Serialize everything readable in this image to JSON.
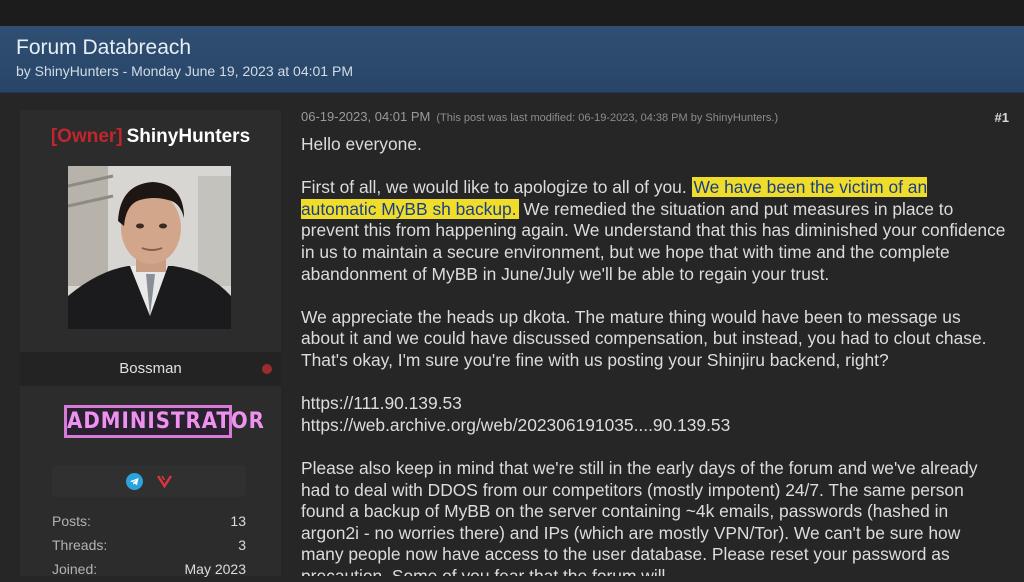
{
  "thread": {
    "title": "Forum Databreach",
    "byline": "by ShinyHunters - Monday June 19, 2023 at 04:01 PM"
  },
  "author": {
    "role_tag": "[Owner]",
    "name": "ShinyHunters",
    "user_title": "Bossman",
    "group_badge": "ADMINISTRATOR",
    "badge_color": "#d77bd7",
    "role_color": "#c0262e",
    "social_icons": [
      "telegram-icon",
      "vk-icon"
    ],
    "stats": [
      {
        "label": "Posts:",
        "value": "13"
      },
      {
        "label": "Threads:",
        "value": "3"
      },
      {
        "label": "Joined:",
        "value": "May 2023"
      }
    ]
  },
  "post": {
    "date": "06-19-2023, 04:01 PM",
    "modified": "(This post was last modified: 06-19-2023, 04:38 PM by ShinyHunters.)",
    "number": "#1",
    "greeting": "Hello everyone.",
    "p1_start": "First of all, we would like to apologize to all of you. ",
    "p1_highlight": "We have been the victim of an automatic MyBB sh backup.",
    "p1_end": " We remedied the situation and put measures in place to prevent this from happening again. We understand that this has diminished your confidence in us to maintain a secure environment, but we hope that with time and the complete abandonment of MyBB in June/July we'll be able to regain your trust.",
    "p2": "We appreciate the heads up dkota. The mature thing would have been to message us about it and we could have discussed compensation, but instead, you had to clout chase. That's okay, I'm sure you're fine with us posting your Shinjiru backend, right?",
    "link1": "https://111.90.139.53",
    "link2": "https://web.archive.org/web/202306191035....90.139.53",
    "p3": "Please also keep in mind that we're still in the early days of the forum and we've already had to deal with DDOS from our competitors (mostly impotent) 24/7. The same person found a backup of MyBB on the server containing ~4k emails, passwords (hashed in argon2i - no worries there) and IPs (which are mostly VPN/Tor). We can't be sure how many people now have access to the user database. Please reset your password as precaution. Some of you fear that the forum will"
  },
  "colors": {
    "header_bg": "#2f4f73",
    "page_bg": "#262626",
    "highlight_bg": "#f0dd2a",
    "highlight_text": "#1c3e8a"
  }
}
